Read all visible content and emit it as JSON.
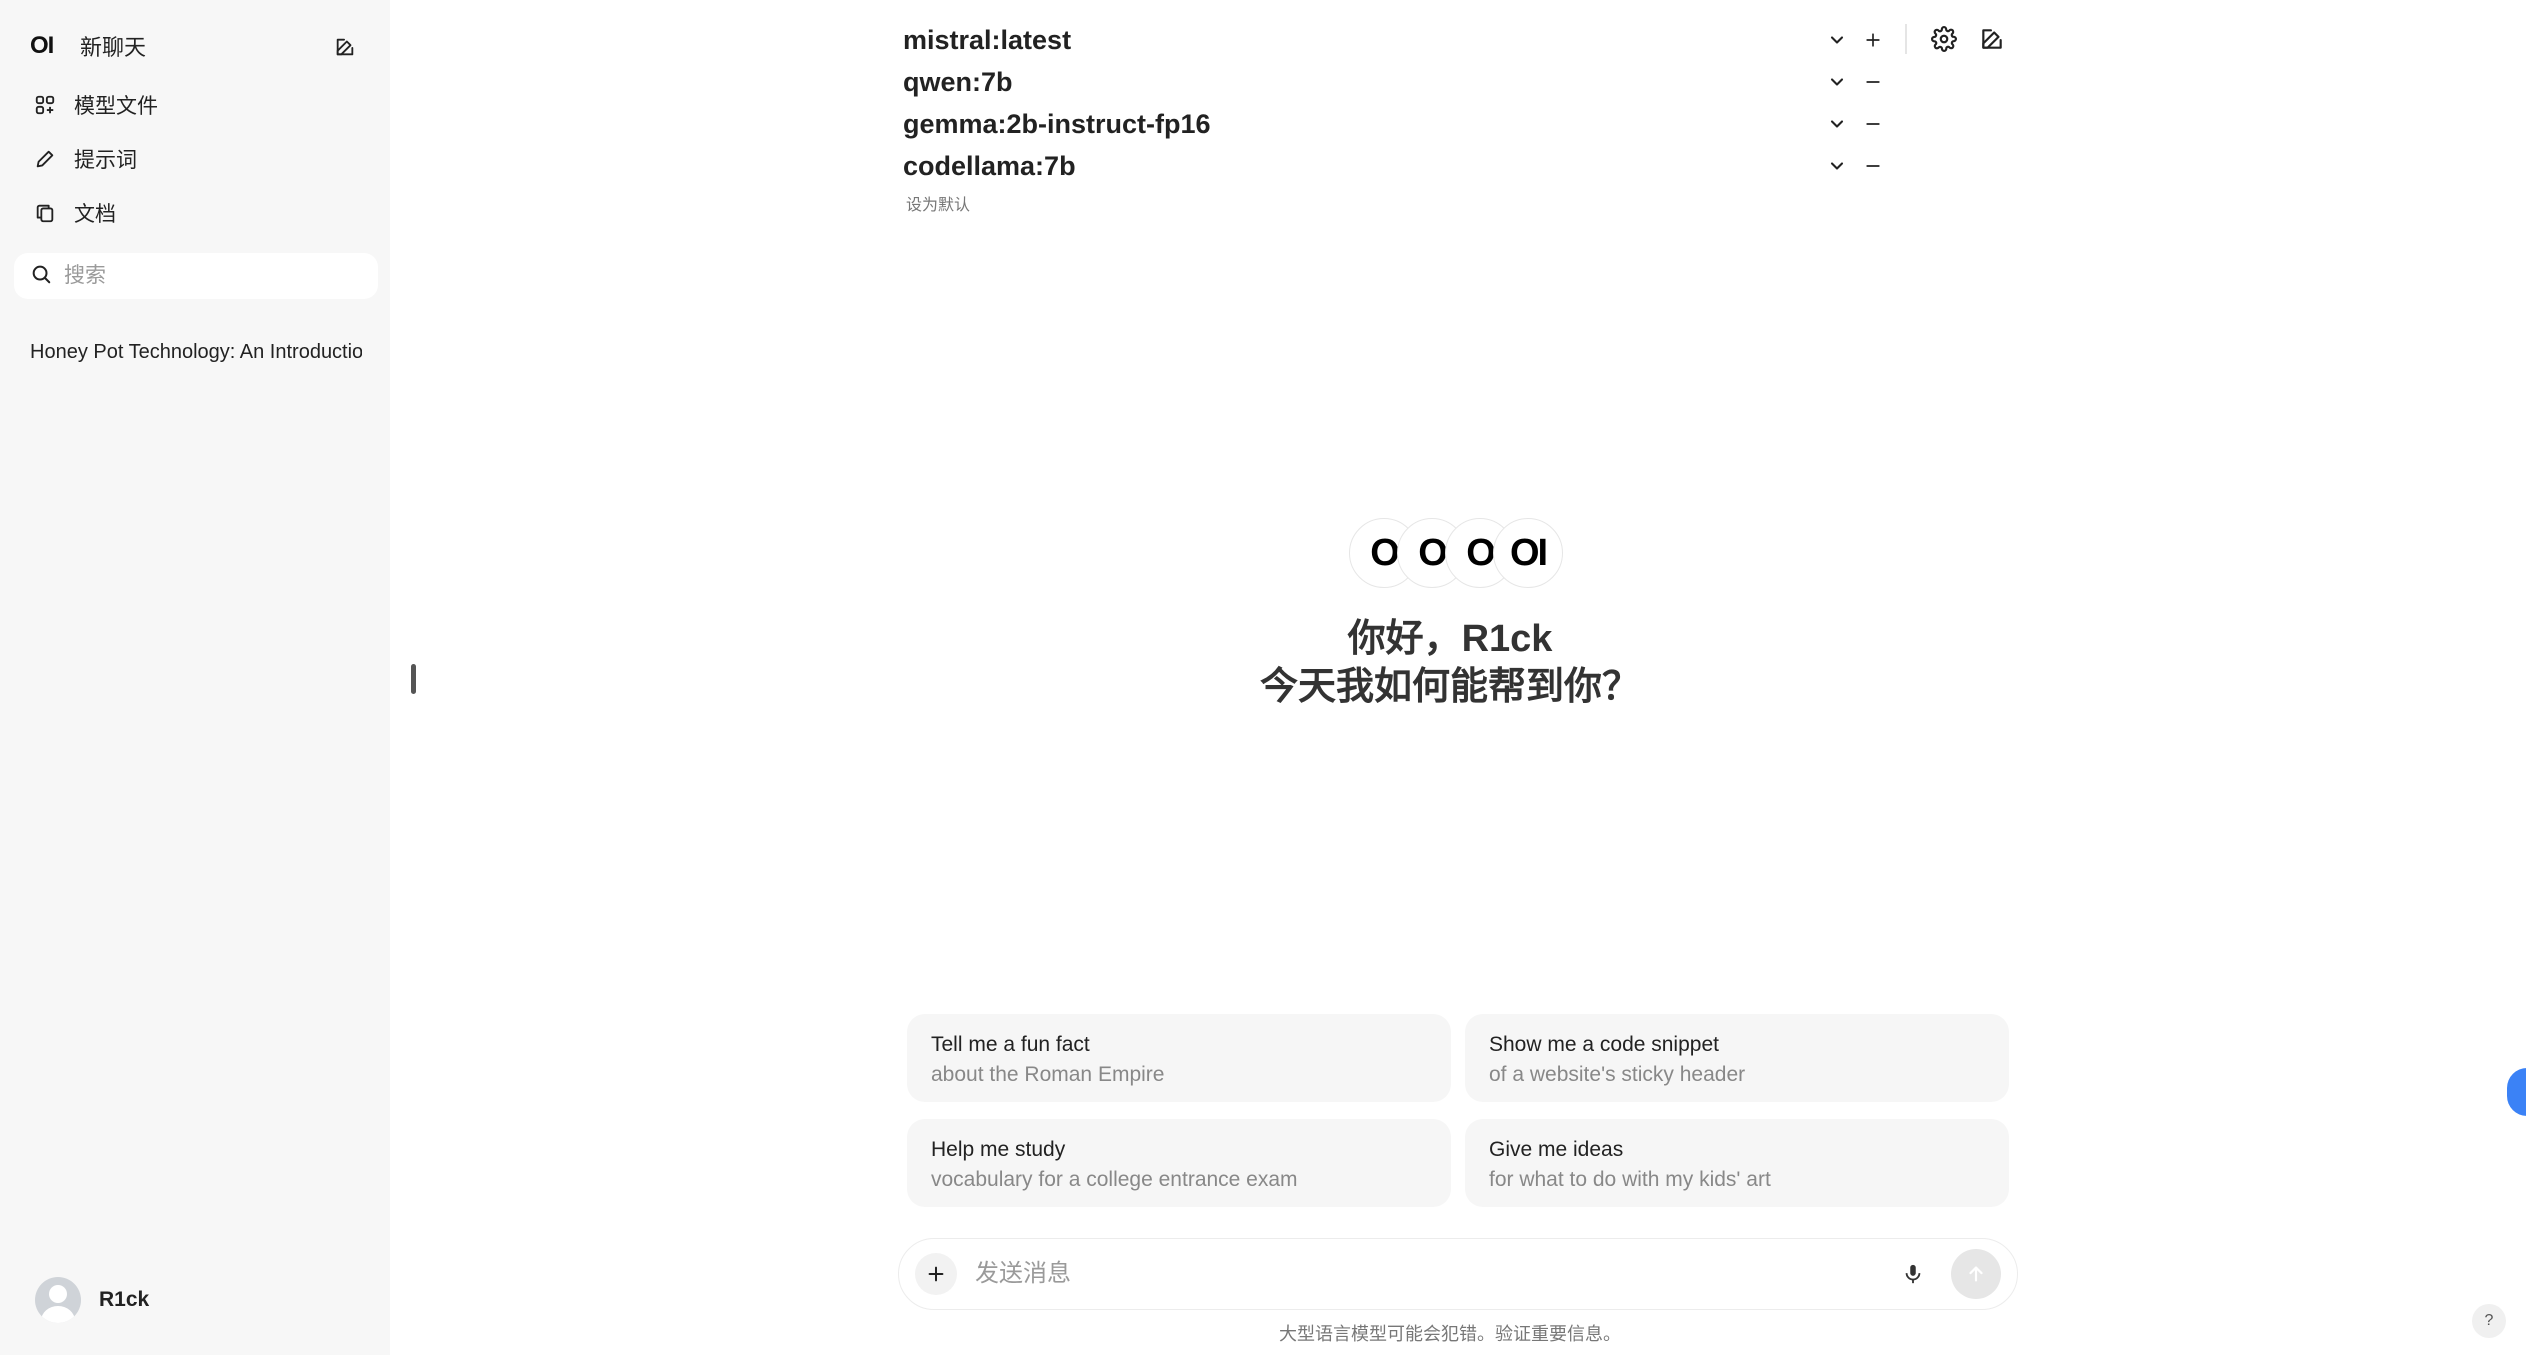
{
  "sidebar": {
    "logo": "OI",
    "new_chat": "新聊天",
    "nav": [
      {
        "label": "模型文件",
        "icon": "grid-icon"
      },
      {
        "label": "提示词",
        "icon": "pencil-icon"
      },
      {
        "label": "文档",
        "icon": "documents-icon"
      }
    ],
    "search_placeholder": "搜索",
    "history": [
      "Honey Pot Technology: An Introduction"
    ],
    "user_name": "R1ck"
  },
  "models": [
    {
      "name": "mistral:latest",
      "action": "add"
    },
    {
      "name": "qwen:7b",
      "action": "remove"
    },
    {
      "name": "gemma:2b-instruct-fp16",
      "action": "remove"
    },
    {
      "name": "codellama:7b",
      "action": "remove"
    }
  ],
  "set_default": "设为默认",
  "hero": {
    "logos": [
      "O",
      "O",
      "O",
      "OI"
    ],
    "greeting_line1": "你好，R1ck",
    "greeting_line2": "今天我如何能帮到你？"
  },
  "suggestions": [
    {
      "title": "Tell me a fun fact",
      "subtitle": "about the Roman Empire"
    },
    {
      "title": "Show me a code snippet",
      "subtitle": "of a website's sticky header"
    },
    {
      "title": "Help me study",
      "subtitle": "vocabulary for a college entrance exam"
    },
    {
      "title": "Give me ideas",
      "subtitle": "for what to do with my kids' art"
    }
  ],
  "input": {
    "placeholder": "发送消息"
  },
  "disclaimer": "大型语言模型可能会犯错。验证重要信息。",
  "help_label": "?",
  "colors": {
    "sidebar_bg": "#f7f7f7",
    "accent": "#3b82f6"
  }
}
